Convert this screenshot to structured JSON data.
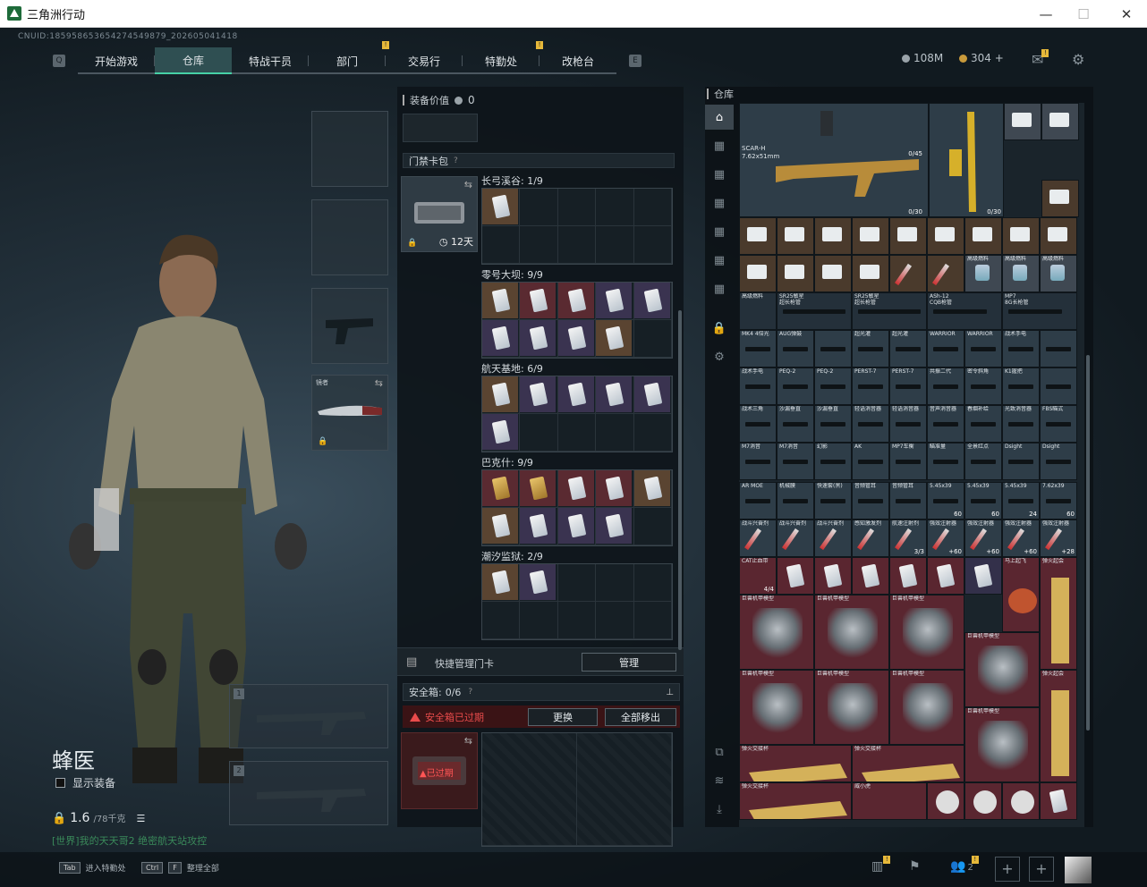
{
  "window": {
    "title": "三角洲行动",
    "minimize": "—",
    "maximize": "☐",
    "close": "✕"
  },
  "header": {
    "cnuid": "CNUID:185958653654274549879_202605041418",
    "tabs": [
      {
        "label": "开始游戏"
      },
      {
        "label": "仓库"
      },
      {
        "label": "特战干员"
      },
      {
        "label": "部门"
      },
      {
        "label": "交易行"
      },
      {
        "label": "特勤处"
      },
      {
        "label": "改枪台"
      }
    ],
    "active_tab": 1,
    "currency": {
      "silver": "108M",
      "gold": "304 +"
    }
  },
  "character": {
    "name": "蜂医",
    "show_equipment": "显示装备",
    "weight": "1.6",
    "weight_max": "/78千克",
    "ticker": "[世界]我的天天哥2 绝密航天站攻控"
  },
  "equip_slots": {
    "melee_label": "镜者",
    "weapon1": "1",
    "weapon2": "2"
  },
  "bottom_keys": [
    {
      "key": "Tab",
      "label": "进入特勤处"
    },
    {
      "key": "Ctrl",
      "key2": "F",
      "label": "整理全部"
    }
  ],
  "bottom_right": {
    "badge": "2"
  },
  "middle": {
    "equip_value_label": "装备价值",
    "equip_value": "0",
    "card_pack_title": "门禁卡包",
    "card_pack_help": "?",
    "card_pack_days": "12天",
    "sections": [
      {
        "title": "长弓溪谷: 1/9"
      },
      {
        "title": "零号大坝: 9/9"
      },
      {
        "title": "航天基地: 6/9"
      },
      {
        "title": "巴克什: 9/9"
      },
      {
        "title": "潮汐监狱: 2/9"
      }
    ],
    "quick_manage": "快捷管理门卡",
    "manage_btn": "管理",
    "safebox_label": "安全箱:",
    "safebox_count": "0/6",
    "safebox_help": "?",
    "expired_text": "安全箱已过期",
    "change_btn": "更换",
    "move_all_btn": "全部移出",
    "box_expired": "已过期"
  },
  "warehouse": {
    "title": "仓库",
    "items_row_top": {
      "gun_name": "SCAR-H",
      "gun_cal": "7.62x51mm",
      "ammo1": "0/45",
      "ammo2": "0/30",
      "ammo3": "0/30"
    },
    "labels": {
      "fuel": "高级燃料",
      "sr25": "SR25敏星",
      "sr25b": "超长枪管",
      "ash": "ASh-12",
      "ash2": "CQB枪管",
      "mp7": "MP7",
      "mp7b": "8G长枪管",
      "mk4": "MK4 4倍光",
      "aug": "AUG弹鼓",
      "ocean": "超光灌",
      "warrior": "WARRIOR",
      "warrior2": "WARRIOR",
      "stock": "战术手电",
      "peq": "PEQ-2",
      "peq2": "PEQ-2",
      "perst": "PERST-7",
      "perst2": "PERST-7",
      "lightset": "共振二代",
      "helm": "密令斜角",
      "k1": "K1握把",
      "tact3": "战术三角",
      "sand": "沙漏垂直",
      "sand2": "沙漏垂直",
      "supp": "轻语消音器",
      "supp2": "轻语消音器",
      "supp3": "音声消音器",
      "tube": "春烟补给",
      "flash": "光致消音器",
      "fbs": "FBS瞄式",
      "m7": "M7消音",
      "m7b": "M7消音",
      "ghost": "幻影",
      "ak": "AK",
      "ak2": "镇空握把",
      "mp7t": "MP7车衡",
      "blue": "瞄准量",
      "fullred": "全景红点",
      "dsight": "Dsight",
      "dsight2": "Dsight",
      "armoe": "AR MOE",
      "pad": "机械膜",
      "fastbag": "快速套(黑)",
      "mid": "音频管耳",
      "mid2": "音频管耳",
      "a545": "5.45x39",
      "a5452": "5.45x39",
      "a5453": "5.45x39",
      "a762": "7.62x39",
      "battle": "战斗兴奋剂",
      "battle2": "战斗兴奋剂",
      "battle3": "战斗兴奋剂",
      "sense": "感知激发剂",
      "aerospace": "航速注射剂",
      "strong": "强效注射器",
      "strong2": "强效注射器",
      "strong3": "强效注射器",
      "strong4": "强效注射器",
      "cat": "CAT止血带",
      "horse": "马上起飞",
      "robot": "巨兽机甲模型",
      "trophy": "弹火起会",
      "goldarm": "弹火交接杯",
      "tiger": "威小虎"
    },
    "counts": {
      "ammo_a": "60",
      "ammo_b": "60",
      "ammo_c": "24",
      "ammo_d": "60",
      "inj_a": "3/3",
      "inj_b": "+60",
      "inj_c": "+60",
      "inj_d": "+60",
      "inj_e": "+28",
      "cat": "4/4"
    }
  }
}
